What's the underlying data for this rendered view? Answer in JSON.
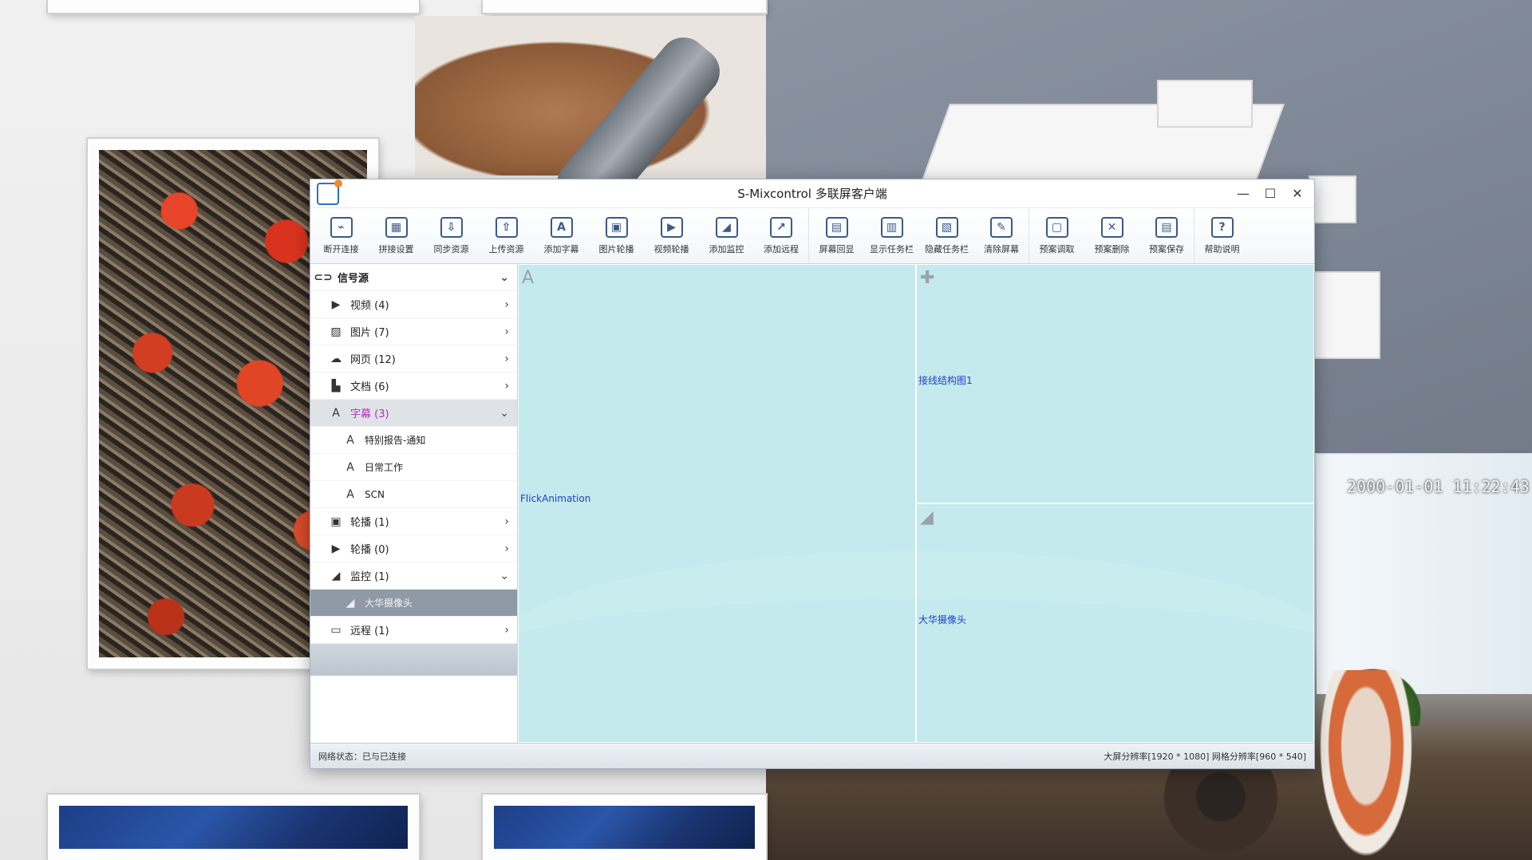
{
  "window": {
    "title": "S-Mixcontrol 多联屏客户端",
    "controls": {
      "minimize": "—",
      "maximize": "☐",
      "close": "✕"
    }
  },
  "background": {
    "clock": "2000-01-01 11:22:43"
  },
  "toolbar": [
    {
      "label": "断开连接",
      "icon": "disconnect-icon",
      "glyph": "⌁"
    },
    {
      "label": "拼接设置",
      "icon": "splice-settings-icon",
      "glyph": "▦"
    },
    {
      "label": "同步资源",
      "icon": "sync-download-icon",
      "glyph": "⇩"
    },
    {
      "label": "上传资源",
      "icon": "upload-icon",
      "glyph": "⇧"
    },
    {
      "label": "添加字幕",
      "icon": "add-caption-icon",
      "glyph": "A"
    },
    {
      "label": "图片轮播",
      "icon": "image-carousel-icon",
      "glyph": "▣"
    },
    {
      "label": "视频轮播",
      "icon": "video-carousel-icon",
      "glyph": "▶"
    },
    {
      "label": "添加监控",
      "icon": "add-camera-icon",
      "glyph": "◢"
    },
    {
      "label": "添加远程",
      "icon": "add-remote-icon",
      "glyph": "↗"
    },
    {
      "label": "屏幕回显",
      "icon": "screen-echo-icon",
      "glyph": "▤"
    },
    {
      "label": "显示任务栏",
      "icon": "show-taskbar-icon",
      "glyph": "▥"
    },
    {
      "label": "隐藏任务栏",
      "icon": "hide-taskbar-icon",
      "glyph": "▧"
    },
    {
      "label": "清除屏幕",
      "icon": "clear-screen-icon",
      "glyph": "✎"
    },
    {
      "label": "预案调取",
      "icon": "plan-load-icon",
      "glyph": "▢"
    },
    {
      "label": "预案删除",
      "icon": "plan-delete-icon",
      "glyph": "✕"
    },
    {
      "label": "预案保存",
      "icon": "plan-save-icon",
      "glyph": "▤"
    },
    {
      "label": "帮助说明",
      "icon": "help-icon",
      "glyph": "?"
    }
  ],
  "sidebar": {
    "root": {
      "label": "信号源",
      "icon": "signal-source-icon",
      "glyph": "⊂⊃"
    },
    "items": [
      {
        "label": "视频 (4)",
        "icon": "video-icon",
        "glyph": "▶",
        "arrow": "›"
      },
      {
        "label": "图片 (7)",
        "icon": "image-icon",
        "glyph": "▨",
        "arrow": "›"
      },
      {
        "label": "网页 (12)",
        "icon": "web-icon",
        "glyph": "☁",
        "arrow": "›"
      },
      {
        "label": "文档 (6)",
        "icon": "document-icon",
        "glyph": "▙",
        "arrow": "›"
      },
      {
        "label": "字幕 (3)",
        "icon": "caption-icon",
        "glyph": "A",
        "arrow": "⌄"
      }
    ],
    "caption_children": [
      {
        "label": "特别报告-通知",
        "icon": "caption-item-icon",
        "glyph": "A"
      },
      {
        "label": "日常工作",
        "icon": "caption-item-icon",
        "glyph": "A"
      },
      {
        "label": "SCN",
        "icon": "caption-item-icon",
        "glyph": "A"
      }
    ],
    "items2": [
      {
        "label": "轮播 (1)",
        "icon": "carousel-icon",
        "glyph": "▣",
        "arrow": "›"
      },
      {
        "label": "轮播 (0)",
        "icon": "carousel-video-icon",
        "glyph": "▶",
        "arrow": "›"
      },
      {
        "label": "监控 (1)",
        "icon": "camera-icon",
        "glyph": "◢",
        "arrow": "⌄"
      }
    ],
    "camera_child": {
      "label": "大华摄像头",
      "icon": "camera-item-icon",
      "glyph": "◢"
    },
    "remote": {
      "label": "远程 (1)",
      "icon": "remote-desktop-icon",
      "glyph": "▭",
      "arrow": "›"
    }
  },
  "canvas": {
    "panes": [
      {
        "label": "FlickAnimation",
        "icon": "caption-pane-icon",
        "glyph": "A"
      },
      {
        "label": "接线结构图1",
        "icon": "image-pane-icon",
        "glyph": "✚"
      },
      {
        "label": "大华摄像头",
        "icon": "camera-pane-icon",
        "glyph": "◢"
      }
    ]
  },
  "status": {
    "left": "网络状态：已与已连接",
    "right": "大屏分辨率[1920 * 1080] 网格分辨率[960 * 540]"
  }
}
